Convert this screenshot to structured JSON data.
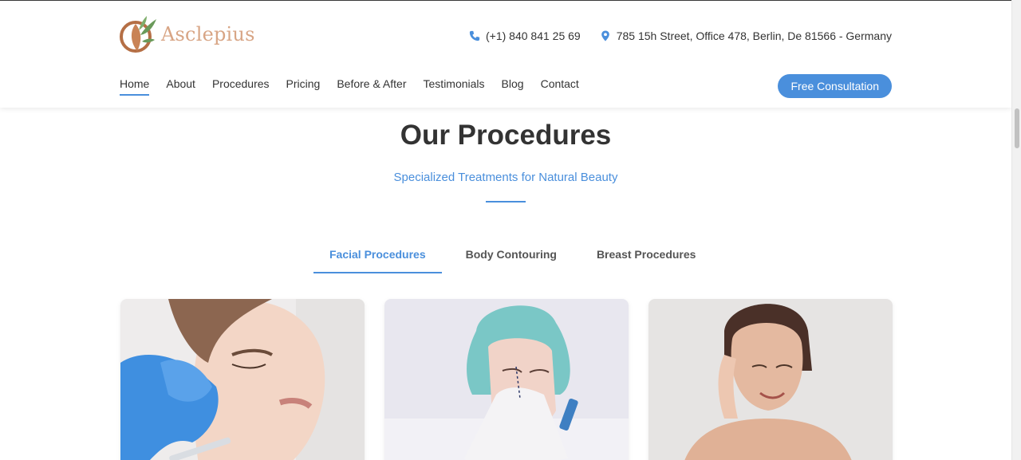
{
  "brand": {
    "name": "Asclepius"
  },
  "contact": {
    "phone": "(+1) 840 841 25 69",
    "address": "785 15h Street, Office 478, Berlin, De 81566 - Germany",
    "phone_icon": "phone-icon",
    "address_icon": "map-pin-icon"
  },
  "nav": {
    "items": [
      {
        "label": "Home",
        "active": true
      },
      {
        "label": "About"
      },
      {
        "label": "Procedures"
      },
      {
        "label": "Pricing"
      },
      {
        "label": "Before & After"
      },
      {
        "label": "Testimonials"
      },
      {
        "label": "Blog"
      },
      {
        "label": "Contact"
      }
    ],
    "cta_label": "Free Consultation"
  },
  "section": {
    "title": "Our Procedures",
    "subtitle": "Specialized Treatments for Natural Beauty"
  },
  "tabs": [
    {
      "label": "Facial Procedures",
      "active": true
    },
    {
      "label": "Body Contouring"
    },
    {
      "label": "Breast Procedures"
    }
  ],
  "cards": [
    {
      "image": "woman-receiving-facial-injection-photo"
    },
    {
      "image": "woman-in-surgical-cap-nose-procedure-photo"
    },
    {
      "image": "smiling-woman-touching-face-photo"
    }
  ],
  "colors": {
    "accent": "#4a8fdc",
    "brand_text": "#d8a585",
    "heading": "#333333"
  }
}
